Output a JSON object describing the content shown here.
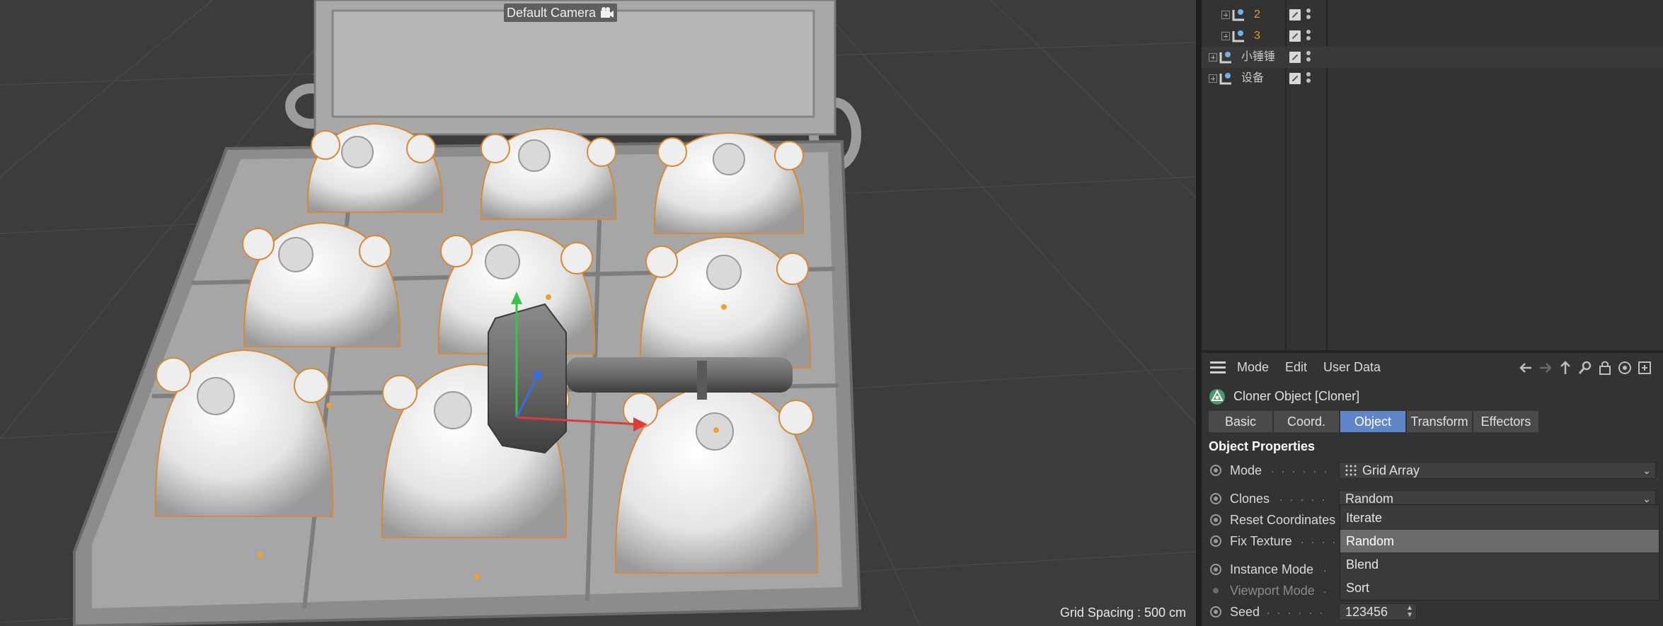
{
  "viewport": {
    "camera_label": "Default Camera",
    "grid_spacing": "Grid Spacing : 500 cm"
  },
  "object_manager": {
    "rows": [
      {
        "name": "2",
        "color": "#e39a3a"
      },
      {
        "name": "3",
        "color": "#e39a3a"
      },
      {
        "name": "小锤锤",
        "color": "#c8c8c8"
      },
      {
        "name": "设备",
        "color": "#c8c8c8"
      }
    ]
  },
  "attributes": {
    "menu": {
      "mode": "Mode",
      "edit": "Edit",
      "user_data": "User Data"
    },
    "title": "Cloner Object [Cloner]",
    "tabs": [
      {
        "label": "Basic",
        "active": false
      },
      {
        "label": "Coord.",
        "active": false
      },
      {
        "label": "Object",
        "active": true
      },
      {
        "label": "Transform",
        "active": false
      },
      {
        "label": "Effectors",
        "active": false
      }
    ],
    "section": "Object Properties",
    "props": {
      "mode_label": "Mode",
      "mode_value": "Grid Array",
      "clones_label": "Clones",
      "clones_value": "Random",
      "reset_label": "Reset Coordinates",
      "fix_label": "Fix Texture",
      "instance_label": "Instance Mode",
      "viewport_label": "Viewport Mode",
      "seed_label": "Seed",
      "seed_value": "123456"
    },
    "dropdown": {
      "options": [
        "Iterate",
        "Random",
        "Blend",
        "Sort"
      ],
      "highlighted": "Random"
    }
  },
  "colors": {
    "accent_tab": "#5e86c9",
    "orange_items": "#e39a3a",
    "axis_x": "#e03a3a",
    "axis_y": "#3ac34a",
    "axis_z": "#3a6ee0"
  }
}
